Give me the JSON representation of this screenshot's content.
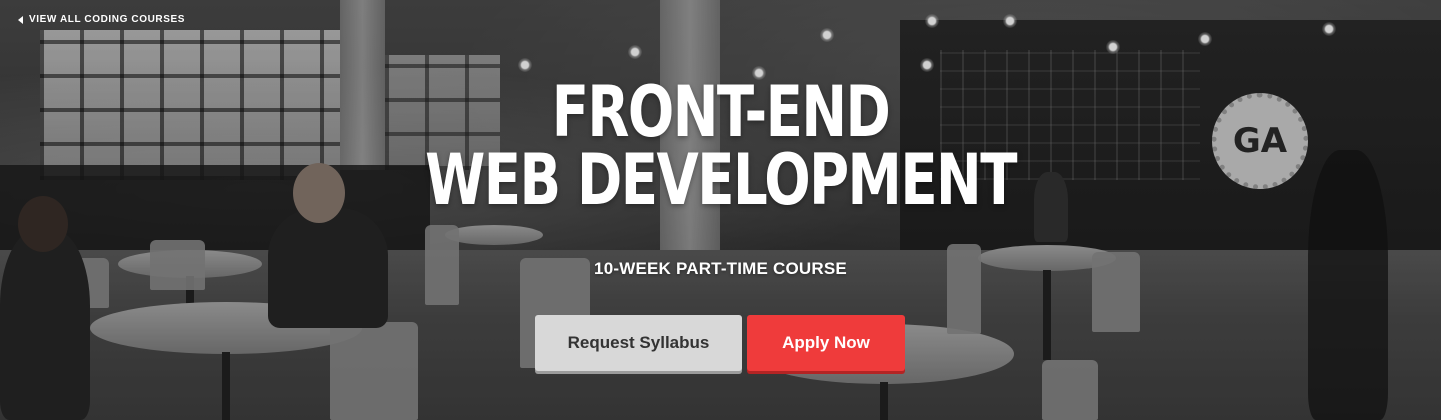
{
  "nav": {
    "back_link_label": "VIEW ALL CODING COURSES",
    "back_icon": "chevron-left-icon"
  },
  "hero": {
    "title_line1": "FRONT-END",
    "title_line2": "WEB DEVELOPMENT",
    "subtitle": "10-WEEK PART-TIME COURSE",
    "badge_text": "GA",
    "background_image": "coworking-space-black-and-white-photo"
  },
  "actions": {
    "request_syllabus_label": "Request Syllabus",
    "apply_now_label": "Apply Now"
  },
  "colors": {
    "apply_button": "#ef3b3b",
    "syllabus_button": "#d8d8d8",
    "title_text": "#ffffff"
  }
}
